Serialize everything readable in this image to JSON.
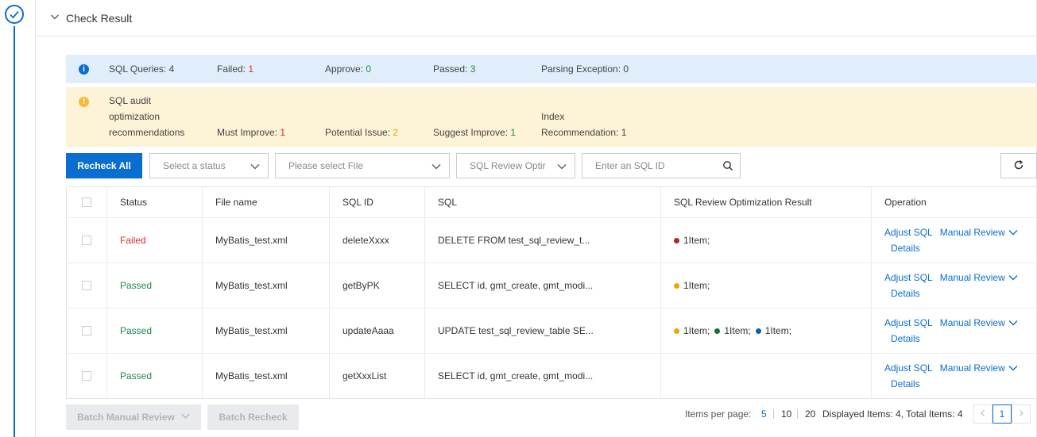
{
  "panel": {
    "title": "Check Result"
  },
  "summary": {
    "sql_queries_label": "SQL Queries:",
    "sql_queries_value": "4",
    "failed_label": "Failed:",
    "failed_value": "1",
    "approve_label": "Approve:",
    "approve_value": "0",
    "passed_label": "Passed:",
    "passed_value": "3",
    "parsing_exception_label": "Parsing Exception:",
    "parsing_exception_value": "0"
  },
  "recommendations": {
    "title_line1": "SQL audit",
    "title_line2": "optimization",
    "title_line3": "recommendations",
    "must_improve_label": "Must Improve:",
    "must_improve_value": "1",
    "potential_issue_label": "Potential Issue:",
    "potential_issue_value": "2",
    "suggest_improve_label": "Suggest Improve:",
    "suggest_improve_value": "1",
    "index_label_line1": "Index",
    "index_label_line2": "Recommendation:",
    "index_value": "1"
  },
  "toolbar": {
    "recheck_all": "Recheck All",
    "status_placeholder": "Select a status",
    "file_placeholder": "Please select File",
    "review_option_placeholder": "SQL Review Optir",
    "sql_id_placeholder": "Enter an SQL ID"
  },
  "table": {
    "headers": {
      "status": "Status",
      "file_name": "File name",
      "sql_id": "SQL ID",
      "sql": "SQL",
      "result": "SQL Review Optimization Result",
      "operation": "Operation"
    },
    "rows": [
      {
        "status": "Failed",
        "file_name": "MyBatis_test.xml",
        "sql_id": "deleteXxxx",
        "sql": "DELETE FROM test_sql_review_t...",
        "results": [
          {
            "color": "#b3261e",
            "text": "1Item;"
          }
        ]
      },
      {
        "status": "Passed",
        "file_name": "MyBatis_test.xml",
        "sql_id": "getByPK",
        "sql": "SELECT id, gmt_create, gmt_modi...",
        "results": [
          {
            "color": "#f0a400",
            "text": "1Item;"
          }
        ]
      },
      {
        "status": "Passed",
        "file_name": "MyBatis_test.xml",
        "sql_id": "updateAaaa",
        "sql": "UPDATE test_sql_review_table SE...",
        "results": [
          {
            "color": "#f0a400",
            "text": "1Item;"
          },
          {
            "color": "#1e6b3c",
            "text": "1Item;"
          },
          {
            "color": "#0a5fb4",
            "text": "1Item;"
          }
        ]
      },
      {
        "status": "Passed",
        "file_name": "MyBatis_test.xml",
        "sql_id": "getXxxList",
        "sql": "SELECT id, gmt_create, gmt_modi...",
        "results": []
      }
    ],
    "operations": {
      "adjust_sql": "Adjust SQL",
      "manual_review": "Manual Review",
      "details": "Details"
    }
  },
  "footer": {
    "batch_manual_review": "Batch Manual Review",
    "batch_recheck": "Batch Recheck",
    "items_per_page_label": "Items per page:",
    "page_sizes": [
      "5",
      "10",
      "20"
    ],
    "selected_page_size": "5",
    "displayed_items": "Displayed Items: 4, Total Items: 4",
    "current_page": "1"
  },
  "colors": {
    "accent": "#0a6ed1",
    "failed": "#d93026",
    "passed": "#1e8a4c",
    "warning": "#f0a400",
    "info_bg": "#dfeefa",
    "warn_bg": "#fdf3d6"
  }
}
